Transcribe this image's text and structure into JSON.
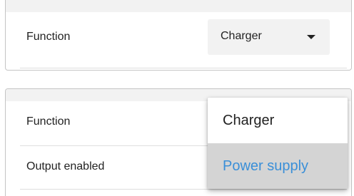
{
  "panel_top": {
    "function_label": "Function",
    "function_value": "Charger"
  },
  "panel_bottom": {
    "function_label": "Function",
    "output_enabled_label": "Output enabled"
  },
  "dropdown": {
    "options": [
      "Charger",
      "Power supply"
    ],
    "highlighted_option": "Power supply",
    "highlight_color": "#3a8fd8"
  }
}
